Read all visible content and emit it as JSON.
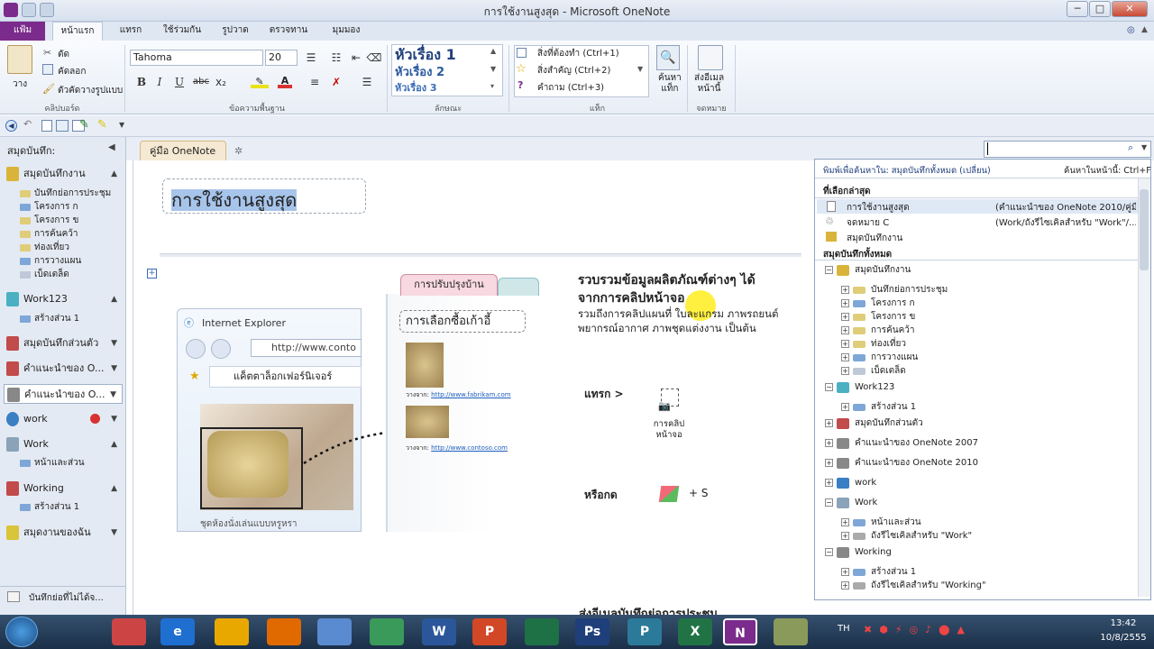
{
  "window": {
    "title": "การใช้งานสูงสุด - Microsoft OneNote",
    "controls": [
      "─",
      "□",
      "✕"
    ]
  },
  "tabs": [
    {
      "label": "แฟ้ม",
      "file": true
    },
    {
      "label": "หน้าแรก",
      "active": true
    },
    {
      "label": "แทรก"
    },
    {
      "label": "ใช้ร่วมกัน"
    },
    {
      "label": "รูปวาด"
    },
    {
      "label": "ตรวจทาน"
    },
    {
      "label": "มุมมอง"
    }
  ],
  "ribbon": {
    "clipboard": {
      "paste": "วาง",
      "cut": "ตัด",
      "copy": "คัดลอก",
      "format_painter": "ตัวคัดวางรูปแบบ",
      "label": "คลิปบอร์ด"
    },
    "font": {
      "name": "Tahoma",
      "size": "20",
      "label": "ข้อความพื้นฐาน",
      "bold": "B",
      "italic": "I",
      "underline": "U",
      "strike": "abc",
      "sub": "x₂"
    },
    "styles": {
      "h1": "หัวเรื่อง 1",
      "h2": "หัวเรื่อง 2",
      "h3": "หัวเรื่อง 3",
      "label": "ลักษณะ"
    },
    "tags": {
      "todo": "สิ่งที่ต้องทำ (Ctrl+1)",
      "important": "สิ่งสำคัญ (Ctrl+2)",
      "question": "คำถาม (Ctrl+3)",
      "find": "ค้นหา\nแท็ก",
      "label": "แท็ก"
    },
    "email": {
      "btn": "ส่งอีเมล\nหน้านี้",
      "label": "จดหมาย"
    }
  },
  "nav": {
    "header": "สมุดบันทึก:",
    "notebooks": [
      {
        "name": "สมุดบันทึกงาน",
        "color": "#d9b43a",
        "sections": [
          "บันทึกย่อการประชุม",
          "โครงการ ก",
          "โครงการ ข",
          "การค้นคว้า",
          "ท่องเที่ยว",
          "การวางแผน",
          "เบ็ดเตล็ด"
        ]
      },
      {
        "name": "Work123",
        "color": "#4bb0c2",
        "sections": [
          "สร้างส่วน 1"
        ]
      },
      {
        "name": "สมุดบันทึกส่วนตัว",
        "color": "#c24b4b",
        "sections": []
      },
      {
        "name": "คำแนะนำของ O...",
        "color": "#c24b4b",
        "sections": []
      },
      {
        "name": "คำแนะนำของ O...",
        "color": "#888888",
        "sections": [],
        "selected": true
      },
      {
        "name": "work",
        "color": "#3a7ec4",
        "sections": []
      },
      {
        "name": "Work",
        "color": "#8aa3b8",
        "sections": [
          "หน้าและส่วน"
        ]
      },
      {
        "name": "Working",
        "color": "#c24b4b",
        "sections": [
          "สร้างส่วน 1"
        ]
      },
      {
        "name": "สมุดงานของฉัน",
        "color": "#d9c43a",
        "sections": []
      }
    ],
    "unfiled": "บันทึกย่อที่ไม่ได้จ..."
  },
  "page": {
    "tab": "คู่มือ OneNote",
    "title": "การใช้งานสูงสุด",
    "heading1": "รวบรวมข้อมูลผลิตภัณฑ์ต่างๆ ได้",
    "heading2": "จากการคลิปหน้าจอ",
    "body": "รวมถึงการคลิปแผนที่ ใบละแกรม ภาพรถยนต์ พยากรณ์อากาศ ภาพชุดแต่งงาน เป็นต้น",
    "insert_label": "แทรก >",
    "clip_label": "การคลิป\nหน้าจอ",
    "or_label": "หรือกด",
    "shortcut": "+ S",
    "bottom": "ส่งอีเมลบันทึกย่อการประชุม",
    "ie_title": "Internet Explorer",
    "ie_url": "http://www.conto",
    "ie_fav": "แค็ตตาล็อกเฟอร์นิเจอร์",
    "ie_caption": "ชุดห้องนั่งเล่นแบบหรูหรา",
    "card_tab": "การปรับปรุงบ้าน",
    "card_title": "การเลือกซื้อเก้าอี้",
    "clip1_prefix": "วางจาก:",
    "clip1_link": "http://www.fabrikam.com",
    "clip2_prefix": "วางจาก:",
    "clip2_link": "http://www.contoso.com"
  },
  "search": {
    "scope": "พิมพ์เพื่อค้นหาใน: สมุดบันทึกทั้งหมด (เปลี่ยน)",
    "find_on_page": "ค้นหาในหน้านี้: Ctrl+F",
    "recent_header": "ที่เลือกล่าสุด",
    "recent": [
      {
        "name": "การใช้งานสูงสุด",
        "path": "(คำแนะนำของ OneNote 2010/คู่มื"
      },
      {
        "name": "จดหมาย C",
        "path": "(Work/ถังรีไซเคิลสำหรับ \"Work\"/..."
      },
      {
        "name": "สมุดบันทึกงาน",
        "path": ""
      }
    ],
    "all_header": "สมุดบันทึกทั้งหมด",
    "tree": [
      {
        "t": "สมุดบันทึกงาน",
        "lvl": 0,
        "sign": "−"
      },
      {
        "t": "บันทึกย่อการประชุม",
        "lvl": 1,
        "sign": "+"
      },
      {
        "t": "โครงการ ก",
        "lvl": 1,
        "sign": "+"
      },
      {
        "t": "โครงการ ข",
        "lvl": 1,
        "sign": "+"
      },
      {
        "t": "การค้นคว้า",
        "lvl": 1,
        "sign": "+"
      },
      {
        "t": "ท่องเที่ยว",
        "lvl": 1,
        "sign": "+"
      },
      {
        "t": "การวางแผน",
        "lvl": 1,
        "sign": "+"
      },
      {
        "t": "เบ็ดเตล็ด",
        "lvl": 1,
        "sign": "+"
      },
      {
        "t": "Work123",
        "lvl": 0,
        "sign": "−"
      },
      {
        "t": "สร้างส่วน 1",
        "lvl": 1,
        "sign": "+"
      },
      {
        "t": "สมุดบันทึกส่วนตัว",
        "lvl": 0,
        "sign": "+"
      },
      {
        "t": "คำแนะนำของ OneNote 2007",
        "lvl": 0,
        "sign": "+"
      },
      {
        "t": "คำแนะนำของ OneNote 2010",
        "lvl": 0,
        "sign": "+"
      },
      {
        "t": "work",
        "lvl": 0,
        "sign": "+"
      },
      {
        "t": "Work",
        "lvl": 0,
        "sign": "−"
      },
      {
        "t": "หน้าและส่วน",
        "lvl": 1,
        "sign": "+"
      },
      {
        "t": "ถังรีไซเคิลสำหรับ \"Work\"",
        "lvl": 1,
        "sign": "+"
      },
      {
        "t": "Working",
        "lvl": 0,
        "sign": "−"
      },
      {
        "t": "สร้างส่วน 1",
        "lvl": 1,
        "sign": "+"
      },
      {
        "t": "ถังรีไซเคิลสำหรับ \"Working\"",
        "lvl": 1,
        "sign": "+"
      },
      {
        "t": "สมุดงานของฉัน",
        "lvl": 0,
        "sign": "+"
      }
    ]
  },
  "taskbar": {
    "lang": "TH",
    "time": "13:42",
    "date": "10/8/2555",
    "apps": [
      "",
      "e",
      "",
      "",
      "",
      "",
      "W",
      "P",
      "",
      "Ps",
      "P",
      "X",
      "N",
      ""
    ]
  }
}
